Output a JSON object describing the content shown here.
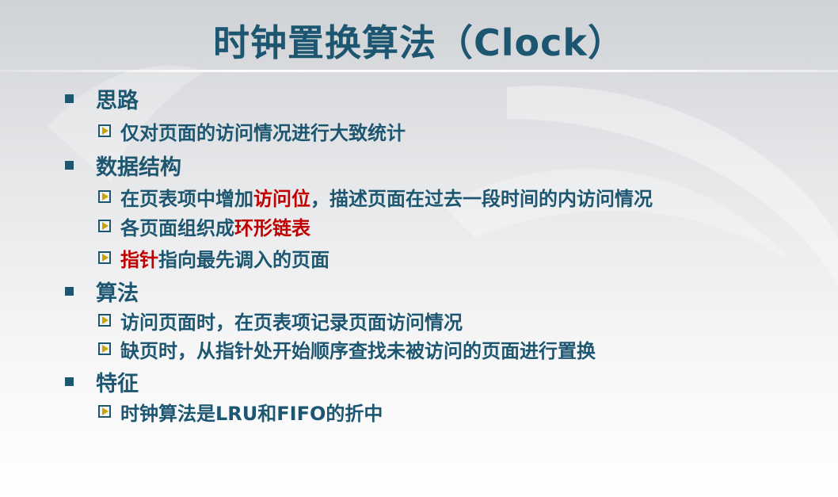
{
  "title": "时钟置换算法（Clock）",
  "sections": [
    {
      "heading": "思路",
      "items": [
        {
          "text": "仅对页面的访问情况进行大致统计"
        }
      ]
    },
    {
      "heading": "数据结构",
      "items": [
        {
          "pre": "在页表项中增加",
          "red": "访问位",
          "post": "，描述页面在过去一段时间的内访问情况"
        },
        {
          "pre": "各页面组织成",
          "red": "环形链表",
          "post": ""
        },
        {
          "pre": "",
          "red": "指针",
          "post": "指向最先调入的页面"
        }
      ]
    },
    {
      "heading": "算法",
      "items": [
        {
          "text": "访问页面时，在页表项记录页面访问情况"
        },
        {
          "text": "缺页时，从指针处开始顺序查找未被访问的页面进行置换"
        }
      ]
    },
    {
      "heading": "特征",
      "items": [
        {
          "text": "时钟算法是LRU和FIFO的折中"
        }
      ]
    }
  ],
  "colors": {
    "text": "#1d5670",
    "highlight": "#c00000",
    "bullet_arrow": "#c9a400"
  }
}
